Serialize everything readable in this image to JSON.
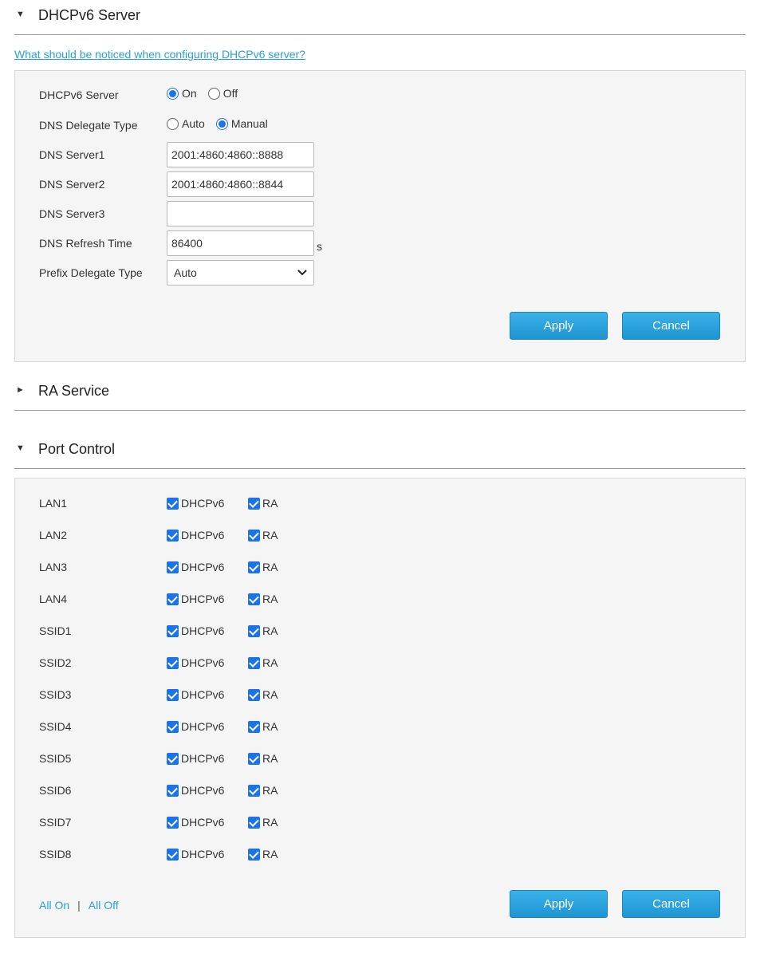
{
  "dhcp_section": {
    "title": "DHCPv6 Server",
    "arrow": "▼",
    "help_link": "What should be noticed when configuring DHCPv6 server?",
    "server_label": "DHCPv6 Server",
    "server_on": "On",
    "server_off": "Off",
    "dns_delegate_label": "DNS Delegate Type",
    "dns_auto": "Auto",
    "dns_manual": "Manual",
    "dns1_label": "DNS Server1",
    "dns1_value": "2001:4860:4860::8888",
    "dns2_label": "DNS Server2",
    "dns2_value": "2001:4860:4860::8844",
    "dns3_label": "DNS Server3",
    "dns3_value": "",
    "refresh_label": "DNS Refresh Time",
    "refresh_value": "86400",
    "refresh_unit": "s",
    "prefix_label": "Prefix Delegate Type",
    "prefix_value": "Auto",
    "apply": "Apply",
    "cancel": "Cancel"
  },
  "ra_section": {
    "title": "RA Service",
    "arrow": "►"
  },
  "port_section": {
    "title": "Port Control",
    "arrow": "▼",
    "opt_dhcp": "DHCPv6",
    "opt_ra": "RA",
    "ports": [
      "LAN1",
      "LAN2",
      "LAN3",
      "LAN4",
      "SSID1",
      "SSID2",
      "SSID3",
      "SSID4",
      "SSID5",
      "SSID6",
      "SSID7",
      "SSID8"
    ],
    "all_on": "All On",
    "separator": "|",
    "all_off": "All Off",
    "apply": "Apply",
    "cancel": "Cancel"
  }
}
